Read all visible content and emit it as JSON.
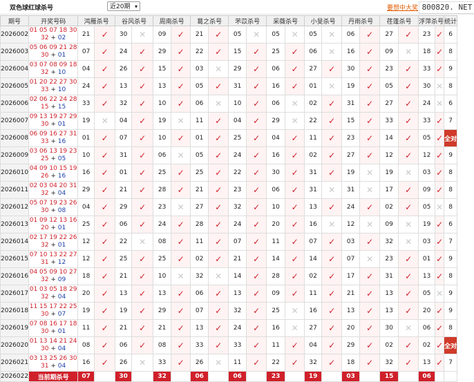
{
  "header": {
    "title": "双色球红球杀号",
    "period_select": "近20期",
    "link": "要想中大奖",
    "watermark": "800820. NET"
  },
  "columns": [
    "期号",
    "开奖号码",
    "鸿雁杀号",
    "谷风杀号",
    "周南杀号",
    "葛之杀号",
    "芣苡杀号",
    "采薇杀号",
    "小旻杀号",
    "丹雨杀号",
    "荏蓬杀号",
    "浮萍杀号",
    "统计"
  ],
  "rows": [
    {
      "period": "2026002",
      "red": "01 05 07 18 30",
      "red2": "32",
      "blue": "02",
      "kills": [
        [
          "21",
          "ok"
        ],
        [
          "30",
          "no"
        ],
        [
          "09",
          "ok"
        ],
        [
          "21",
          "ok"
        ],
        [
          "05",
          "no"
        ],
        [
          "05",
          "no"
        ],
        [
          "05",
          "no"
        ],
        [
          "06",
          "ok"
        ],
        [
          "27",
          "ok"
        ],
        [
          "23",
          "ok"
        ]
      ],
      "stat": "6"
    },
    {
      "period": "2026003",
      "red": "05 06 09 21 28",
      "red2": "30",
      "blue": "01",
      "kills": [
        [
          "07",
          "ok"
        ],
        [
          "24",
          "ok"
        ],
        [
          "29",
          "ok"
        ],
        [
          "22",
          "ok"
        ],
        [
          "15",
          "ok"
        ],
        [
          "25",
          "ok"
        ],
        [
          "06",
          "no"
        ],
        [
          "16",
          "ok"
        ],
        [
          "09",
          "no"
        ],
        [
          "18",
          "ok"
        ]
      ],
      "stat": "8"
    },
    {
      "period": "2026004",
      "red": "03 07 08 09 18",
      "red2": "32",
      "blue": "10",
      "kills": [
        [
          "04",
          "ok"
        ],
        [
          "26",
          "ok"
        ],
        [
          "15",
          "ok"
        ],
        [
          "03",
          "no"
        ],
        [
          "29",
          "ok"
        ],
        [
          "06",
          "ok"
        ],
        [
          "27",
          "ok"
        ],
        [
          "30",
          "ok"
        ],
        [
          "23",
          "ok"
        ],
        [
          "33",
          "ok"
        ]
      ],
      "stat": "9"
    },
    {
      "period": "2026005",
      "red": "01 20 22 27 30",
      "red2": "33",
      "blue": "10",
      "kills": [
        [
          "24",
          "ok"
        ],
        [
          "13",
          "ok"
        ],
        [
          "13",
          "ok"
        ],
        [
          "05",
          "ok"
        ],
        [
          "31",
          "ok"
        ],
        [
          "16",
          "ok"
        ],
        [
          "01",
          "no"
        ],
        [
          "19",
          "ok"
        ],
        [
          "05",
          "ok"
        ],
        [
          "30",
          "no"
        ]
      ],
      "stat": "8"
    },
    {
      "period": "2026006",
      "red": "02 06 22 24 28",
      "red2": "15",
      "blue": "15",
      "kills": [
        [
          "33",
          "ok"
        ],
        [
          "32",
          "ok"
        ],
        [
          "10",
          "ok"
        ],
        [
          "06",
          "no"
        ],
        [
          "10",
          "ok"
        ],
        [
          "06",
          "no"
        ],
        [
          "02",
          "ok"
        ],
        [
          "31",
          "ok"
        ],
        [
          "27",
          "ok"
        ],
        [
          "24",
          "no"
        ]
      ],
      "stat": "6"
    },
    {
      "period": "2026007",
      "red": "09 13 19 27 29",
      "red2": "30",
      "blue": "01",
      "kills": [
        [
          "19",
          "no"
        ],
        [
          "04",
          "ok"
        ],
        [
          "19",
          "no"
        ],
        [
          "11",
          "ok"
        ],
        [
          "04",
          "ok"
        ],
        [
          "29",
          "no"
        ],
        [
          "22",
          "ok"
        ],
        [
          "15",
          "ok"
        ],
        [
          "33",
          "ok"
        ],
        [
          "33",
          "ok"
        ]
      ],
      "stat": "7"
    },
    {
      "period": "2026008",
      "red": "06 09 16 27 31",
      "red2": "33",
      "blue": "16",
      "kills": [
        [
          "01",
          "ok"
        ],
        [
          "07",
          "ok"
        ],
        [
          "10",
          "ok"
        ],
        [
          "01",
          "ok"
        ],
        [
          "25",
          "ok"
        ],
        [
          "04",
          "ok"
        ],
        [
          "11",
          "ok"
        ],
        [
          "23",
          "ok"
        ],
        [
          "14",
          "ok"
        ],
        [
          "05",
          "ok"
        ]
      ],
      "stat": "全对"
    },
    {
      "period": "2026009",
      "red": "03 06 13 19 23",
      "red2": "25",
      "blue": "05",
      "kills": [
        [
          "10",
          "ok"
        ],
        [
          "31",
          "ok"
        ],
        [
          "06",
          "no"
        ],
        [
          "05",
          "ok"
        ],
        [
          "24",
          "ok"
        ],
        [
          "16",
          "ok"
        ],
        [
          "02",
          "ok"
        ],
        [
          "27",
          "ok"
        ],
        [
          "12",
          "ok"
        ],
        [
          "12",
          "ok"
        ]
      ],
      "stat": "9"
    },
    {
      "period": "2026010",
      "red": "04 09 10 15 19",
      "red2": "26",
      "blue": "16",
      "kills": [
        [
          "16",
          "ok"
        ],
        [
          "01",
          "ok"
        ],
        [
          "25",
          "ok"
        ],
        [
          "25",
          "ok"
        ],
        [
          "22",
          "ok"
        ],
        [
          "30",
          "ok"
        ],
        [
          "31",
          "ok"
        ],
        [
          "19",
          "no"
        ],
        [
          "19",
          "no"
        ],
        [
          "03",
          "ok"
        ]
      ],
      "stat": "8"
    },
    {
      "period": "2026011",
      "red": "02 03 04 20 31",
      "red2": "32",
      "blue": "04",
      "kills": [
        [
          "29",
          "ok"
        ],
        [
          "21",
          "ok"
        ],
        [
          "28",
          "ok"
        ],
        [
          "21",
          "ok"
        ],
        [
          "23",
          "ok"
        ],
        [
          "06",
          "ok"
        ],
        [
          "31",
          "no"
        ],
        [
          "31",
          "no"
        ],
        [
          "17",
          "ok"
        ],
        [
          "09",
          "ok"
        ]
      ],
      "stat": "8"
    },
    {
      "period": "2026012",
      "red": "05 07 19 23 26",
      "red2": "30",
      "blue": "08",
      "kills": [
        [
          "04",
          "ok"
        ],
        [
          "29",
          "ok"
        ],
        [
          "23",
          "no"
        ],
        [
          "27",
          "ok"
        ],
        [
          "32",
          "ok"
        ],
        [
          "10",
          "ok"
        ],
        [
          "13",
          "ok"
        ],
        [
          "24",
          "ok"
        ],
        [
          "02",
          "ok"
        ],
        [
          "05",
          "no"
        ]
      ],
      "stat": "8"
    },
    {
      "period": "2026013",
      "red": "01 09 12 13 16",
      "red2": "20",
      "blue": "01",
      "kills": [
        [
          "25",
          "ok"
        ],
        [
          "06",
          "ok"
        ],
        [
          "24",
          "ok"
        ],
        [
          "28",
          "ok"
        ],
        [
          "24",
          "ok"
        ],
        [
          "20",
          "ok"
        ],
        [
          "16",
          "no"
        ],
        [
          "12",
          "no"
        ],
        [
          "09",
          "no"
        ],
        [
          "19",
          "ok"
        ]
      ],
      "stat": "6"
    },
    {
      "period": "2026014",
      "red": "02 17 19 22 26",
      "red2": "32",
      "blue": "01",
      "kills": [
        [
          "12",
          "ok"
        ],
        [
          "22",
          "no"
        ],
        [
          "08",
          "ok"
        ],
        [
          "11",
          "ok"
        ],
        [
          "07",
          "ok"
        ],
        [
          "11",
          "ok"
        ],
        [
          "07",
          "ok"
        ],
        [
          "03",
          "ok"
        ],
        [
          "32",
          "no"
        ],
        [
          "03",
          "ok"
        ]
      ],
      "stat": "7"
    },
    {
      "period": "2026015",
      "red": "07 10 13 22 27",
      "red2": "31",
      "blue": "12",
      "kills": [
        [
          "12",
          "ok"
        ],
        [
          "25",
          "ok"
        ],
        [
          "25",
          "ok"
        ],
        [
          "02",
          "ok"
        ],
        [
          "21",
          "ok"
        ],
        [
          "14",
          "ok"
        ],
        [
          "14",
          "ok"
        ],
        [
          "07",
          "no"
        ],
        [
          "23",
          "ok"
        ],
        [
          "01",
          "ok"
        ]
      ],
      "stat": "9"
    },
    {
      "period": "2026016",
      "red": "04 05 09 10 27",
      "red2": "32",
      "blue": "09",
      "kills": [
        [
          "18",
          "ok"
        ],
        [
          "21",
          "ok"
        ],
        [
          "10",
          "no"
        ],
        [
          "32",
          "no"
        ],
        [
          "14",
          "ok"
        ],
        [
          "28",
          "ok"
        ],
        [
          "02",
          "ok"
        ],
        [
          "17",
          "ok"
        ],
        [
          "31",
          "ok"
        ],
        [
          "13",
          "ok"
        ]
      ],
      "stat": "8"
    },
    {
      "period": "2026017",
      "red": "01 03 05 18 29",
      "red2": "32",
      "blue": "04",
      "kills": [
        [
          "20",
          "ok"
        ],
        [
          "13",
          "ok"
        ],
        [
          "13",
          "ok"
        ],
        [
          "06",
          "ok"
        ],
        [
          "13",
          "ok"
        ],
        [
          "09",
          "ok"
        ],
        [
          "11",
          "ok"
        ],
        [
          "21",
          "ok"
        ],
        [
          "13",
          "ok"
        ],
        [
          "05",
          "no"
        ]
      ],
      "stat": "9"
    },
    {
      "period": "2026018",
      "red": "11 15 17 22 25",
      "red2": "30",
      "blue": "07",
      "kills": [
        [
          "19",
          "ok"
        ],
        [
          "19",
          "ok"
        ],
        [
          "29",
          "ok"
        ],
        [
          "07",
          "ok"
        ],
        [
          "32",
          "ok"
        ],
        [
          "25",
          "no"
        ],
        [
          "16",
          "ok"
        ],
        [
          "13",
          "ok"
        ],
        [
          "13",
          "ok"
        ],
        [
          "20",
          "ok"
        ]
      ],
      "stat": "9"
    },
    {
      "period": "2026019",
      "red": "07 08 16 17 18",
      "red2": "30",
      "blue": "01",
      "kills": [
        [
          "11",
          "ok"
        ],
        [
          "21",
          "ok"
        ],
        [
          "21",
          "ok"
        ],
        [
          "13",
          "ok"
        ],
        [
          "24",
          "ok"
        ],
        [
          "16",
          "no"
        ],
        [
          "27",
          "ok"
        ],
        [
          "20",
          "ok"
        ],
        [
          "30",
          "no"
        ],
        [
          "06",
          "ok"
        ]
      ],
      "stat": "8"
    },
    {
      "period": "2026020",
      "red": "01 13 14 21 24",
      "red2": "30",
      "blue": "04",
      "kills": [
        [
          "08",
          "ok"
        ],
        [
          "06",
          "ok"
        ],
        [
          "08",
          "ok"
        ],
        [
          "33",
          "ok"
        ],
        [
          "33",
          "ok"
        ],
        [
          "11",
          "ok"
        ],
        [
          "04",
          "ok"
        ],
        [
          "29",
          "ok"
        ],
        [
          "02",
          "ok"
        ],
        [
          "02",
          "ok"
        ]
      ],
      "stat": "全对"
    },
    {
      "period": "2026021",
      "red": "03 13 25 26 30",
      "red2": "31",
      "blue": "04",
      "kills": [
        [
          "16",
          "ok"
        ],
        [
          "26",
          "no"
        ],
        [
          "33",
          "ok"
        ],
        [
          "26",
          "no"
        ],
        [
          "11",
          "ok"
        ],
        [
          "22",
          "ok"
        ],
        [
          "32",
          "ok"
        ],
        [
          "18",
          "ok"
        ],
        [
          "32",
          "ok"
        ],
        [
          "13",
          "ok"
        ]
      ],
      "stat": "7"
    }
  ],
  "current": {
    "period": "2026022",
    "label": "当前期杀号",
    "kills": [
      "07",
      "30",
      "32",
      "06",
      "06",
      "23",
      "19",
      "03",
      "15",
      "06"
    ]
  },
  "symbols": {
    "ok": "✓",
    "no": "✕",
    "plus": "+"
  }
}
